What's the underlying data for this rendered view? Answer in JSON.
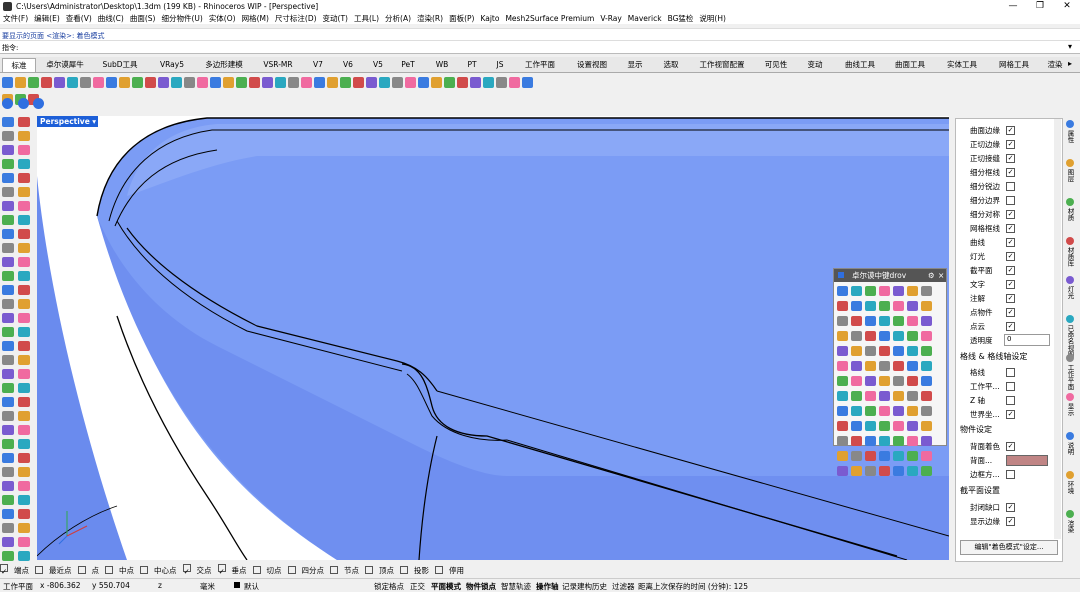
{
  "window": {
    "title": "C:\\Users\\Administrator\\Desktop\\1.3dm (199 KB) - Rhinoceros WIP - [Perspective]",
    "min": "—",
    "max": "❐",
    "close": "✕"
  },
  "menu": [
    "文件(F)",
    "编辑(E)",
    "查看(V)",
    "曲线(C)",
    "曲面(S)",
    "细分物件(U)",
    "实体(O)",
    "网格(M)",
    "尺寸标注(D)",
    "变动(T)",
    "工具(L)",
    "分析(A)",
    "渲染(R)",
    "面板(P)",
    "Kajto",
    "Mesh2Surface Premium",
    "V-Ray",
    "Maverick",
    "BG猛检",
    "说明(H)"
  ],
  "command": {
    "history": "要显示的页面 <渲染>: 着色模式",
    "prompt": "指令:"
  },
  "tabs": [
    "标准",
    "卓尔谟犀牛",
    "SubD工具",
    "VRay5",
    "多边形建模",
    "VSR-MR",
    "V7",
    "V6",
    "V5",
    "PeT",
    "WB",
    "PT",
    "JS",
    "工作平面",
    "设置视图",
    "显示",
    "选取",
    "工作视窗配置",
    "可见性",
    "变动",
    "曲线工具",
    "曲面工具",
    "实体工具",
    "网格工具",
    "渲染"
  ],
  "viewport": {
    "label": "Perspective"
  },
  "float_window": {
    "title": "卓尔谟中键drov"
  },
  "panel": {
    "rows": [
      {
        "label": "曲面边缘",
        "checked": true
      },
      {
        "label": "正切边缘",
        "checked": true
      },
      {
        "label": "正切接缝",
        "checked": true
      },
      {
        "label": "细分框线",
        "checked": true
      },
      {
        "label": "细分锐边",
        "checked": false
      },
      {
        "label": "细分边界",
        "checked": false
      },
      {
        "label": "细分对称",
        "checked": true
      },
      {
        "label": "网格框线",
        "checked": true
      },
      {
        "label": "曲线",
        "checked": true
      },
      {
        "label": "灯光",
        "checked": true
      },
      {
        "label": "截平面",
        "checked": true
      },
      {
        "label": "文字",
        "checked": true
      },
      {
        "label": "注解",
        "checked": true
      },
      {
        "label": "点物件",
        "checked": true
      },
      {
        "label": "点云",
        "checked": true
      }
    ],
    "transparency_label": "透明度",
    "transparency_value": "0",
    "grid_section": "格线 & 格线轴设定",
    "grid_rows": [
      {
        "label": "格线",
        "checked": false
      },
      {
        "label": "工作平...",
        "checked": false
      },
      {
        "label": "Z 轴",
        "checked": false
      },
      {
        "label": "世界坐...",
        "checked": true
      }
    ],
    "object_section": "物件设定",
    "object_rows": [
      {
        "label": "背面着色",
        "checked": true
      },
      {
        "label": "背面...",
        "checked": null
      },
      {
        "label": "边框方...",
        "checked": false
      }
    ],
    "backface_color": "#c08585",
    "clip_section": "截平面设置",
    "clip_rows": [
      {
        "label": "封闭缺口",
        "checked": true
      },
      {
        "label": "显示边缘",
        "checked": true
      }
    ],
    "edit_button": "编辑\"着色模式\"设定..."
  },
  "right_strip": [
    "属性",
    "图层",
    "材质",
    "材质库",
    "灯光",
    "已命名视图",
    "工作平面",
    "显示",
    "说明",
    "环境",
    "渲染"
  ],
  "snaps": [
    {
      "label": "端点",
      "checked": true
    },
    {
      "label": "最近点",
      "checked": false
    },
    {
      "label": "点",
      "checked": false
    },
    {
      "label": "中点",
      "checked": false
    },
    {
      "label": "中心点",
      "checked": false
    },
    {
      "label": "交点",
      "checked": true
    },
    {
      "label": "垂点",
      "checked": true
    },
    {
      "label": "切点",
      "checked": false
    },
    {
      "label": "四分点",
      "checked": false
    },
    {
      "label": "节点",
      "checked": false
    },
    {
      "label": "顶点",
      "checked": false
    },
    {
      "label": "投影",
      "checked": false
    },
    {
      "label": "停用",
      "checked": false
    }
  ],
  "status": {
    "cplane": "工作平面",
    "x": "x -806.362",
    "y": "y 550.704",
    "z": "z",
    "unit": "毫米",
    "layer": "默认",
    "lock_grid": "锁定格点",
    "ortho": "正交",
    "planar": "平面模式",
    "osnap": "物件锁点",
    "smarttrack": "智慧轨迹",
    "gumball": "操作轴",
    "history": "记录建构历史",
    "filter": "过滤器",
    "autosave": "距离上次保存的时间 (分钟): 125"
  },
  "colors": {
    "model": "#7b9cf5",
    "model_light": "#a6bcfa",
    "accent": "#1d5fd8"
  }
}
